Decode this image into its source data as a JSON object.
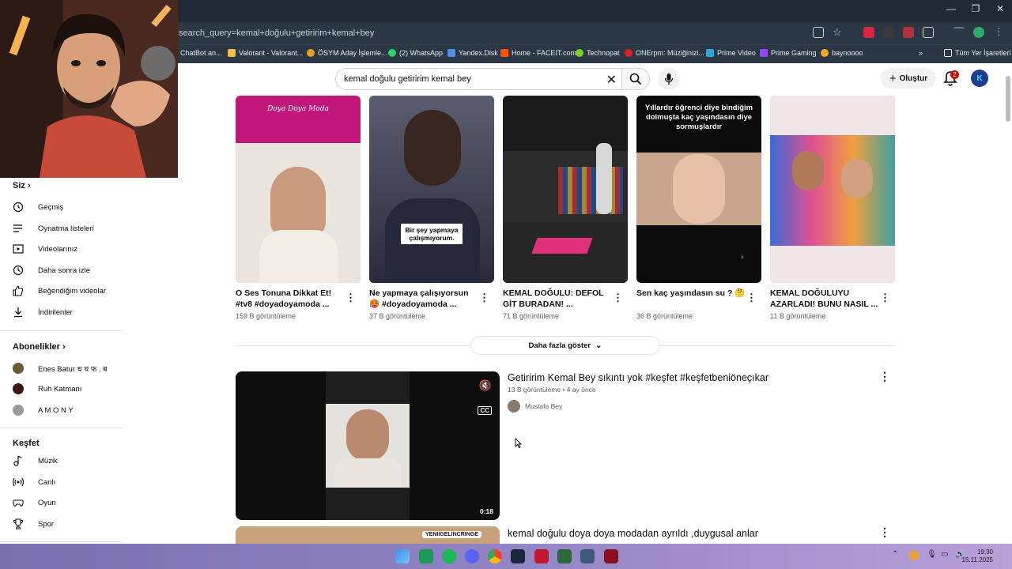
{
  "browser": {
    "url": "search_query=kemal+doğulu+getiririm+kemal+bey",
    "bookmarks": [
      {
        "label": "ChatBot an...",
        "color": "#e06030"
      },
      {
        "label": "Valorant - Valorant...",
        "color": "#f0c040"
      },
      {
        "label": "ÖSYM Aday İşlemle...",
        "color": "#e8a020"
      },
      {
        "label": "(2) WhatsApp",
        "color": "#25d366"
      },
      {
        "label": "Yandex.Disk",
        "color": "#4a90e2"
      },
      {
        "label": "Home - FACEIT.com",
        "color": "#ff5500"
      },
      {
        "label": "Technopat",
        "color": "#7ed321"
      },
      {
        "label": "ONErpm: Müziğinizi...",
        "color": "#e02020"
      },
      {
        "label": "Prime Video",
        "color": "#2ea7e0"
      },
      {
        "label": "Prime Gaming",
        "color": "#9146ff"
      },
      {
        "label": "baynoooo",
        "color": "#f5a623"
      }
    ],
    "all_bookmarks": "Tüm Yer İşaretleri"
  },
  "header": {
    "search_value": "kemal doğulu getiririm kemal bey",
    "create_label": "Oluştur",
    "notif_count": "2",
    "avatar_letter": "K"
  },
  "sidebar": {
    "you_title": "Siz",
    "you_items": [
      {
        "label": "Geçmiş",
        "icon": "history-icon"
      },
      {
        "label": "Oynatma listeleri",
        "icon": "playlist-icon"
      },
      {
        "label": "Videolarınız",
        "icon": "your-videos-icon"
      },
      {
        "label": "Daha sonra izle",
        "icon": "watch-later-icon"
      },
      {
        "label": "Beğendiğim videolar",
        "icon": "like-icon"
      },
      {
        "label": "İndirilenler",
        "icon": "download-icon"
      }
    ],
    "subs_title": "Abonelikler",
    "subs": [
      {
        "label": "Enes Batur ध थ फ . ब",
        "color": "#6b5a3a"
      },
      {
        "label": "Ruh Katmanı",
        "color": "#3a1a10"
      },
      {
        "label": "A M O N Y",
        "color": "#9a9a9a"
      }
    ],
    "explore_title": "Keşfet",
    "explore_items": [
      {
        "label": "Müzik",
        "icon": "music-icon"
      },
      {
        "label": "Canlı",
        "icon": "live-icon"
      },
      {
        "label": "Oyun",
        "icon": "gaming-icon"
      },
      {
        "label": "Spor",
        "icon": "trophy-icon"
      }
    ]
  },
  "shorts": [
    {
      "title": "O Ses Tonuna Dikkat Et! #tv8 #doyadoyamoda ...",
      "views": "159 B görüntüleme",
      "overlay": "Doya Doya Moda",
      "bg": "#c0187a"
    },
    {
      "title": "Ne yapmaya çalışıyorsun 🥵 #doyadoyamoda ...",
      "views": "37 B görüntüleme",
      "overlay": "Bir şey yapmaya çalışmıyorum.",
      "bg": "#2c2a3a"
    },
    {
      "title": "KEMAL DOĞULU: DEFOL GİT BURADAN! ...",
      "views": "71 B görüntüleme",
      "overlay": "",
      "bg": "#1a1a1a"
    },
    {
      "title": "Sen kaç yaşındasın su ? 🤔",
      "views": "36 B görüntüleme",
      "overlay": "Yıllardır öğrenci diye bindiğim dolmuşta kaç yaşındasın diye sormuşlardır",
      "bg": "#0b0b0b"
    },
    {
      "title": "KEMAL DOĞULUYU AZARLADI! BUNU NASIL ...",
      "views": "11 B görüntüleme",
      "overlay": "",
      "bg": "#5a5560"
    }
  ],
  "show_more": "Daha fazla göster",
  "videos": [
    {
      "title": "Getiririm Kemal Bey sıkıntı yok #keşfet #keşfetbeniöneçıkar",
      "meta": "13 B görüntüleme • 4 ay önce",
      "channel": "Mustafa Bey",
      "duration": "0:18"
    },
    {
      "title": "kemal doğulu doya doya modadan ayrıldı ,duygusal anlar",
      "channel_tag": "YENIIGELINCRINGE"
    }
  ],
  "taskbar": {
    "time": "19:30",
    "date": "15.11.2025"
  }
}
